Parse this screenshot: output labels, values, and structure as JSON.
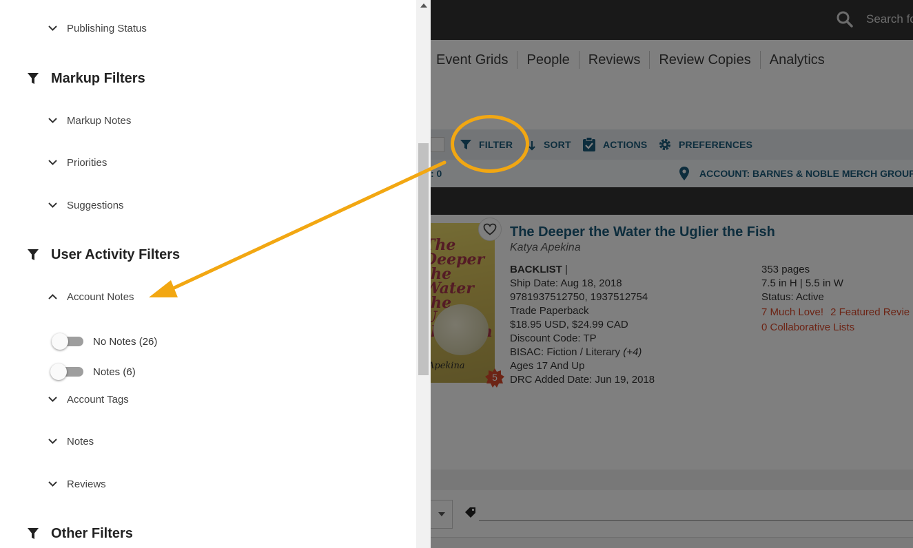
{
  "header": {
    "search_placeholder": "Search fo"
  },
  "nav": {
    "items": [
      "Event Grids",
      "People",
      "Reviews",
      "Review Copies",
      "Analytics"
    ]
  },
  "toolbar": {
    "filter_label": "FILTER",
    "sort_label": "SORT",
    "actions_label": "ACTIONS",
    "preferences_label": "PREFERENCES"
  },
  "subbar": {
    "count_text": ": 0",
    "account_label": "ACCOUNT: BARNES & NOBLE MERCH GROUP"
  },
  "book": {
    "cover_title": "The Deeper the Water the Uglier the Fish",
    "cover_author": "Apekina",
    "badge_count": "5",
    "title": "The Deeper the Water the Uglier the Fish",
    "author": "Katya Apekina",
    "status_tag": "BACKLIST",
    "ship_date": "Ship Date: Aug 18, 2018",
    "isbns": "9781937512750, 1937512754",
    "format": "Trade Paperback",
    "price": "$18.95 USD, $24.99 CAD",
    "discount": "Discount Code: TP",
    "bisac_prefix": "BISAC: Fiction / Literary",
    "bisac_more": "(+4)",
    "ages": "Ages 17 And Up",
    "drc_added": "DRC Added Date: Jun 19, 2018",
    "pages": "353 pages",
    "dimensions": "7.5 in H | 5.5 in W",
    "status": "Status: Active",
    "much_love": "7 Much Love!",
    "featured_reviews": "2 Featured Revie",
    "collaborative_lists": "0 Collaborative Lists"
  },
  "panel": {
    "publishing_status": "Publishing Status",
    "markup_filters": "Markup Filters",
    "markup_notes": "Markup Notes",
    "priorities": "Priorities",
    "suggestions": "Suggestions",
    "user_activity_filters": "User Activity Filters",
    "account_notes": "Account Notes",
    "no_notes": "No Notes (26)",
    "notes_toggle": "Notes (6)",
    "account_tags": "Account Tags",
    "notes": "Notes",
    "reviews": "Reviews",
    "other_filters": "Other Filters"
  },
  "colors": {
    "accent_blue": "#1a5a7a",
    "annotation_orange": "#f2a712",
    "link_red": "#d9482b"
  }
}
